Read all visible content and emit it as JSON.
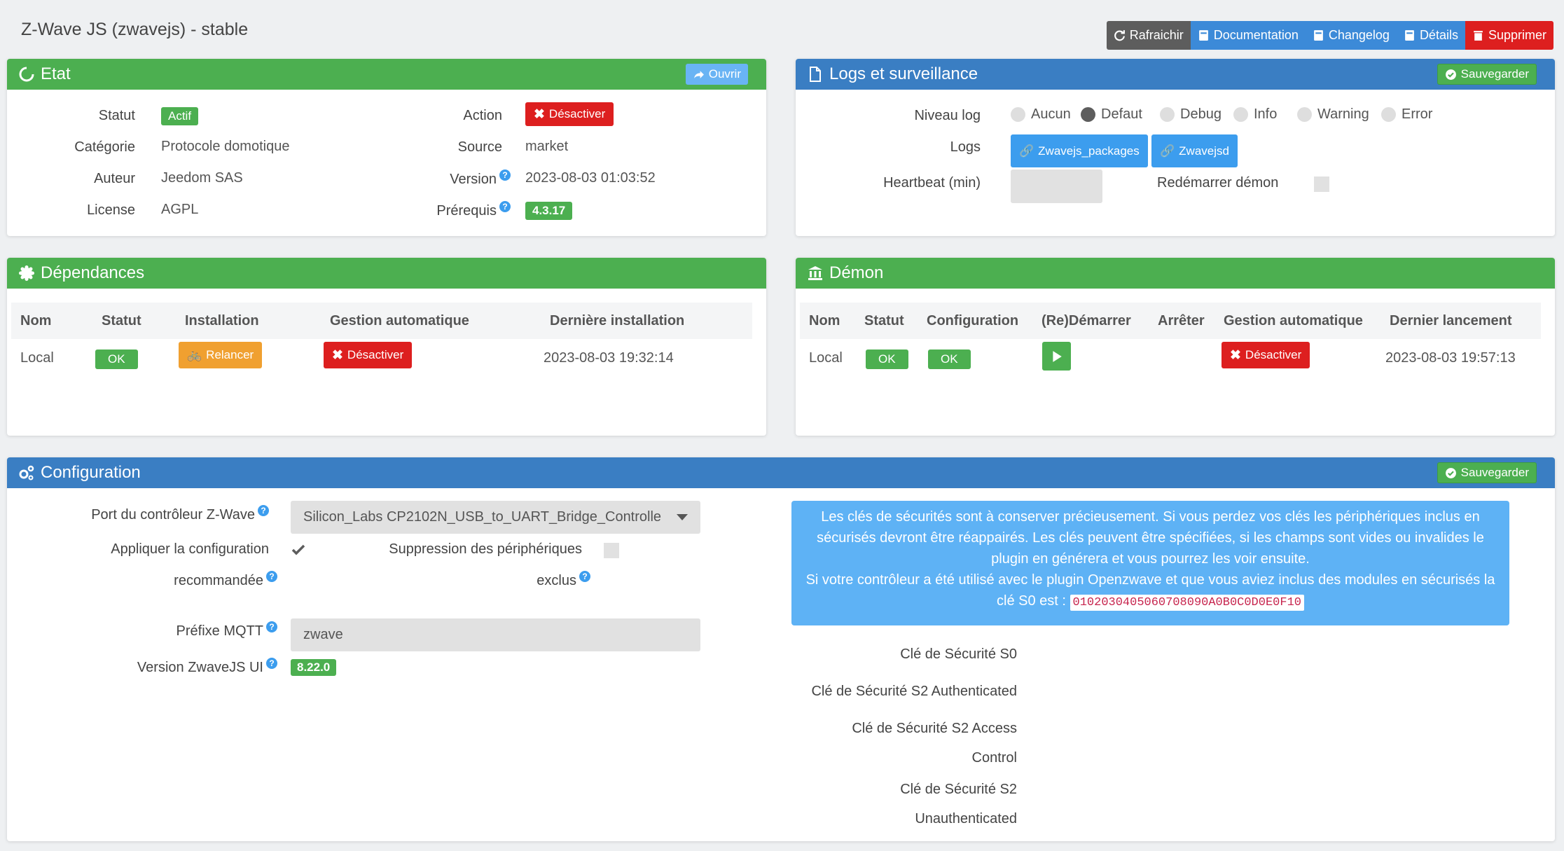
{
  "header": {
    "title": "Z-Wave JS (zwavejs) - stable",
    "toolbar": {
      "refresh": "Rafraichir",
      "documentation": "Documentation",
      "changelog": "Changelog",
      "details": "Détails",
      "delete": "Supprimer"
    }
  },
  "etat": {
    "title": "Etat",
    "open_button": "Ouvrir",
    "fields": {
      "statut_label": "Statut",
      "statut_value": "Actif",
      "categorie_label": "Catégorie",
      "categorie_value": "Protocole domotique",
      "auteur_label": "Auteur",
      "auteur_value": "Jeedom SAS",
      "license_label": "License",
      "license_value": "AGPL",
      "action_label": "Action",
      "action_button": "Désactiver",
      "source_label": "Source",
      "source_value": "market",
      "version_label": "Version",
      "version_value": "2023-08-03 01:03:52",
      "prerequis_label": "Prérequis",
      "prerequis_value": "4.3.17"
    }
  },
  "logs": {
    "title": "Logs et surveillance",
    "save_button": "Sauvegarder",
    "niveau_label": "Niveau log",
    "levels": [
      "Aucun",
      "Defaut",
      "Debug",
      "Info",
      "Warning",
      "Error"
    ],
    "selected_level": "Defaut",
    "logs_label": "Logs",
    "log_buttons": [
      "Zwavejs_packages",
      "Zwavejsd"
    ],
    "heartbeat_label": "Heartbeat (min)",
    "heartbeat_value": "",
    "restart_label": "Redémarrer démon"
  },
  "dependances": {
    "title": "Dépendances",
    "columns": [
      "Nom",
      "Statut",
      "Installation",
      "Gestion automatique",
      "Dernière installation"
    ],
    "row": {
      "nom": "Local",
      "statut": "OK",
      "installation": "Relancer",
      "gestion": "Désactiver",
      "derniere": "2023-08-03 19:32:14"
    }
  },
  "demon": {
    "title": "Démon",
    "columns": [
      "Nom",
      "Statut",
      "Configuration",
      "(Re)Démarrer",
      "Arrêter",
      "Gestion automatique",
      "Dernier lancement"
    ],
    "row": {
      "nom": "Local",
      "statut": "OK",
      "configuration": "OK",
      "gestion": "Désactiver",
      "dernier": "2023-08-03 19:57:13"
    }
  },
  "configuration": {
    "title": "Configuration",
    "save_button": "Sauvegarder",
    "port_label": "Port du contrôleur Z-Wave",
    "port_value": "Silicon_Labs CP2102N_USB_to_UART_Bridge_Controlle",
    "apply_label_1": "Appliquer la configuration",
    "apply_label_2": "recommandée",
    "suppression_label_1": "Suppression des périphériques",
    "suppression_label_2": "exclus",
    "mqtt_label": "Préfixe MQTT",
    "mqtt_value": "zwave",
    "ui_version_label": "Version ZwaveJS UI",
    "ui_version_value": "8.22.0",
    "info_text": "Les clés de sécurités sont à conserver précieusement. Si vous perdez vos clés les périphériques inclus en sécurisés devront être réappairés. Les clés peuvent être spécifiées, si les champs sont vides ou invalides le plugin en générera et vous pourrez les voir ensuite.",
    "info_text_2": "Si votre contrôleur a été utilisé avec le plugin Openzwave et que vous aviez inclus des modules en sécurisés la clé S0 est :",
    "s0_key": "0102030405060708090A0B0C0D0E0F10",
    "keys": {
      "s0": "Clé de Sécurité S0",
      "s2_auth": "Clé de Sécurité S2 Authenticated",
      "s2_access_1": "Clé de Sécurité S2 Access",
      "s2_access_2": "Control",
      "s2_unauth_1": "Clé de Sécurité S2",
      "s2_unauth_2": "Unauthenticated"
    }
  },
  "colors": {
    "green": "#4caf50",
    "blue": "#3a7ec3",
    "red": "#dd1f1f",
    "orange": "#f0a030",
    "info": "#5eb2f5"
  }
}
